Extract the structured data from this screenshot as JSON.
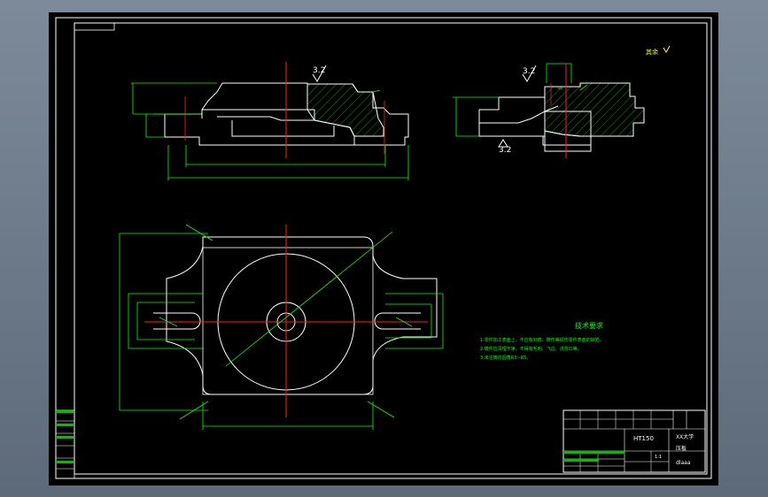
{
  "roughness": {
    "front_view": "3.2",
    "side_view_top": "3.2",
    "side_view_bottom": "3.2",
    "general": "其余"
  },
  "notes": {
    "title": "技术要求",
    "items": [
      "1.零件加工表面上，不应有划痕、擦伤等损伤零件表面的缺陷。",
      "2.铸件应清理干净，不得有毛刺、飞边、浇冒口等。",
      "3.未注铸造圆角R3~R5。"
    ]
  },
  "title_block": {
    "material": "HT150",
    "part_name": "压板",
    "drawing_no": "dlaaa",
    "scale": "1:1",
    "school": "XX大学"
  }
}
